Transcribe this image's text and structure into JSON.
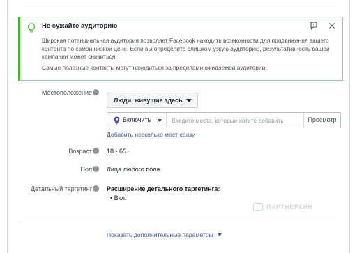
{
  "colors": {
    "accent": "#42b72a",
    "link": "#365899",
    "text": "#1d2129",
    "muted": "#4b4f56",
    "pin": "#5b45b5"
  },
  "alert": {
    "icon": "lightbulb-icon",
    "title": "Не сужайте аудиторию",
    "paragraph1": "Широкая потенциальная аудитория позволяет Facebook находить возможности для продвижения вашего контента по самой низкой цене. Если вы определите слишком узкую аудиторию, результативность вашей кампании может снизиться.",
    "paragraph2": "Самые полезные контакты могут находиться за пределами ожидаемой аудитории."
  },
  "location": {
    "label": "Местоположение",
    "audience_dropdown": "Люди, живущие здесь",
    "include_dropdown": "Включить",
    "search_placeholder": "Введите места, которые хотите добавить",
    "browse_button": "Просмотр",
    "bulk_add_link": "Добавить несколько мест сразу"
  },
  "age": {
    "label": "Возраст",
    "value": "18 - 65+"
  },
  "gender": {
    "label": "Пол",
    "value": "Лица любого пола"
  },
  "detailed": {
    "label": "Детальный таргетинг",
    "heading": "Расширение детального таргетинга:",
    "bullet": "Вкл."
  },
  "watermark": "ПАРТНЕРКИН",
  "footer": {
    "more_options": "Показать дополнительные параметры"
  }
}
